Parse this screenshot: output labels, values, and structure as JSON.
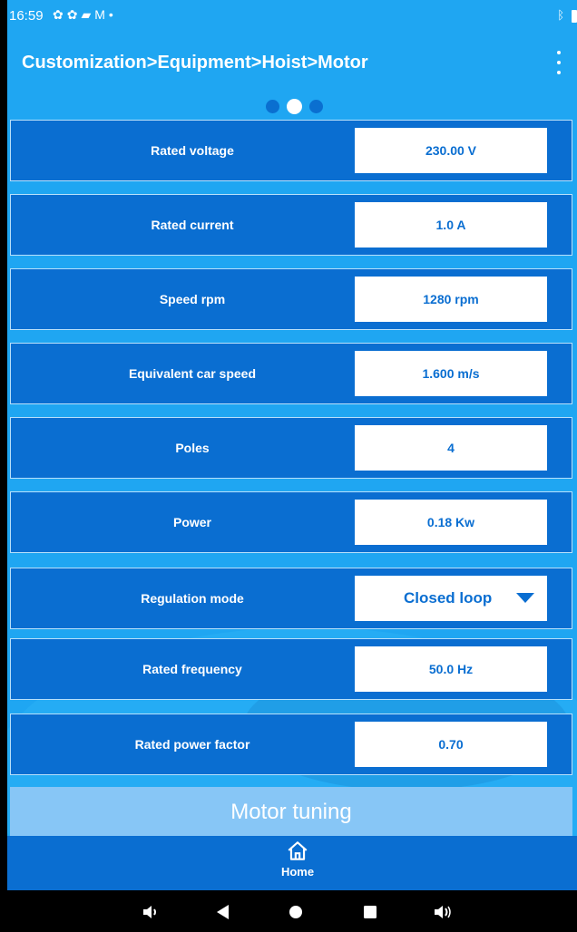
{
  "status_bar": {
    "time": "16:59",
    "icons": [
      "settings-icon",
      "settings-icon",
      "image-icon",
      "mail-icon",
      "dot-icon"
    ],
    "right_icons": [
      "bluetooth-icon",
      "battery-icon"
    ]
  },
  "app_bar": {
    "title": "Customization>Equipment>Hoist>Motor",
    "menu_icon": "more-vert-icon"
  },
  "pager": {
    "count": 3,
    "active_index": 1
  },
  "params": [
    {
      "label": "Rated voltage",
      "value": "230.00 V"
    },
    {
      "label": "Rated current",
      "value": "1.0 A"
    },
    {
      "label": "Speed rpm",
      "value": "1280 rpm"
    },
    {
      "label": "Equivalent car speed",
      "value": "1.600 m/s"
    },
    {
      "label": "Poles",
      "value": "4"
    },
    {
      "label": "Power",
      "value": "0.18 Kw"
    },
    {
      "label": "Regulation mode",
      "value": "Closed loop",
      "type": "dropdown"
    },
    {
      "label": "Rated frequency",
      "value": "50.0 Hz"
    },
    {
      "label": "Rated power factor",
      "value": "0.70"
    }
  ],
  "motor_tuning_label": "Motor tuning",
  "bottom_nav": {
    "home_label": "Home",
    "home_icon": "home-icon"
  },
  "system_nav": [
    "volume-down-icon",
    "back-icon",
    "home-circle-icon",
    "recents-icon",
    "volume-up-icon"
  ],
  "colors": {
    "background": "#1fa6f2",
    "primary": "#0a6ed1",
    "field_bg": "#ffffff",
    "tuning_bg": "#87c6f6"
  }
}
